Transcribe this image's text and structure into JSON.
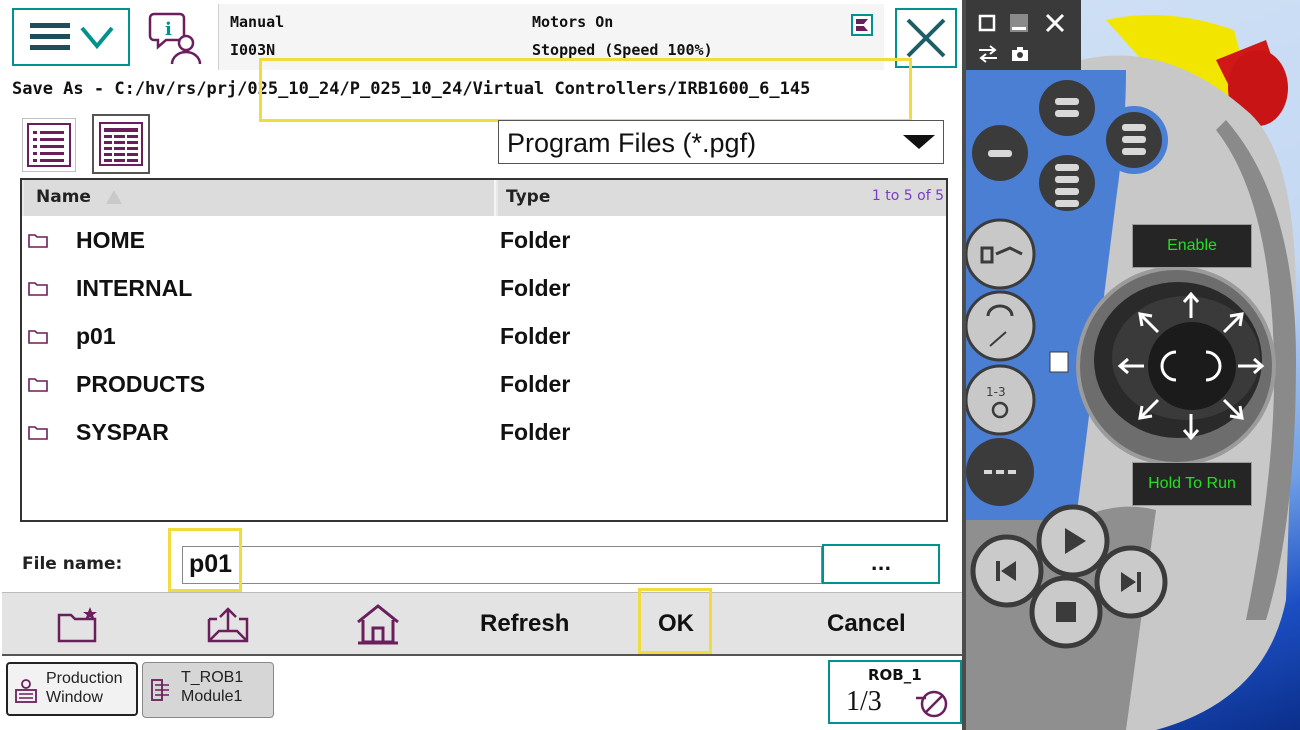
{
  "status": {
    "mode": "Manual",
    "controller": "I003N",
    "motors": "Motors On",
    "state": "Stopped (Speed 100%)"
  },
  "path": {
    "text": "Save As - C:/hv/rs/prj/025_10_24/P_025_10_24/Virtual Controllers/IRB1600_6_145"
  },
  "filter": {
    "selected": "Program Files (*.pgf)"
  },
  "table": {
    "headers": {
      "name": "Name",
      "type": "Type"
    },
    "count": "1 to 5 of 5",
    "rows": [
      {
        "name": "HOME",
        "type": "Folder"
      },
      {
        "name": "INTERNAL",
        "type": "Folder"
      },
      {
        "name": "p01",
        "type": "Folder"
      },
      {
        "name": "PRODUCTS",
        "type": "Folder"
      },
      {
        "name": "SYSPAR",
        "type": "Folder"
      }
    ]
  },
  "filename": {
    "label": "File name:",
    "value": "p01",
    "browse_label": "..."
  },
  "commands": {
    "new_folder_icon": "new-folder-icon",
    "up_icon": "folder-up-icon",
    "home_icon": "home-icon",
    "refresh": "Refresh",
    "ok": "OK",
    "cancel": "Cancel"
  },
  "taskbar": {
    "production_line1": "Production",
    "production_line2": "Window",
    "rob_line1": "T_ROB1",
    "rob_line2": "Module1"
  },
  "quickset": {
    "robot": "ROB_1",
    "increment": "1/3"
  },
  "hardware": {
    "enable_label": "Enable",
    "hold_label": "Hold To Run"
  },
  "colors": {
    "accent_teal": "#00928f",
    "highlight_yellow": "#f0dc3c",
    "hw_green_text": "#22e022",
    "hw_blue_ring": "#4a7fd4",
    "estop_red": "#d01818",
    "hw_yellow": "#f2e600"
  }
}
